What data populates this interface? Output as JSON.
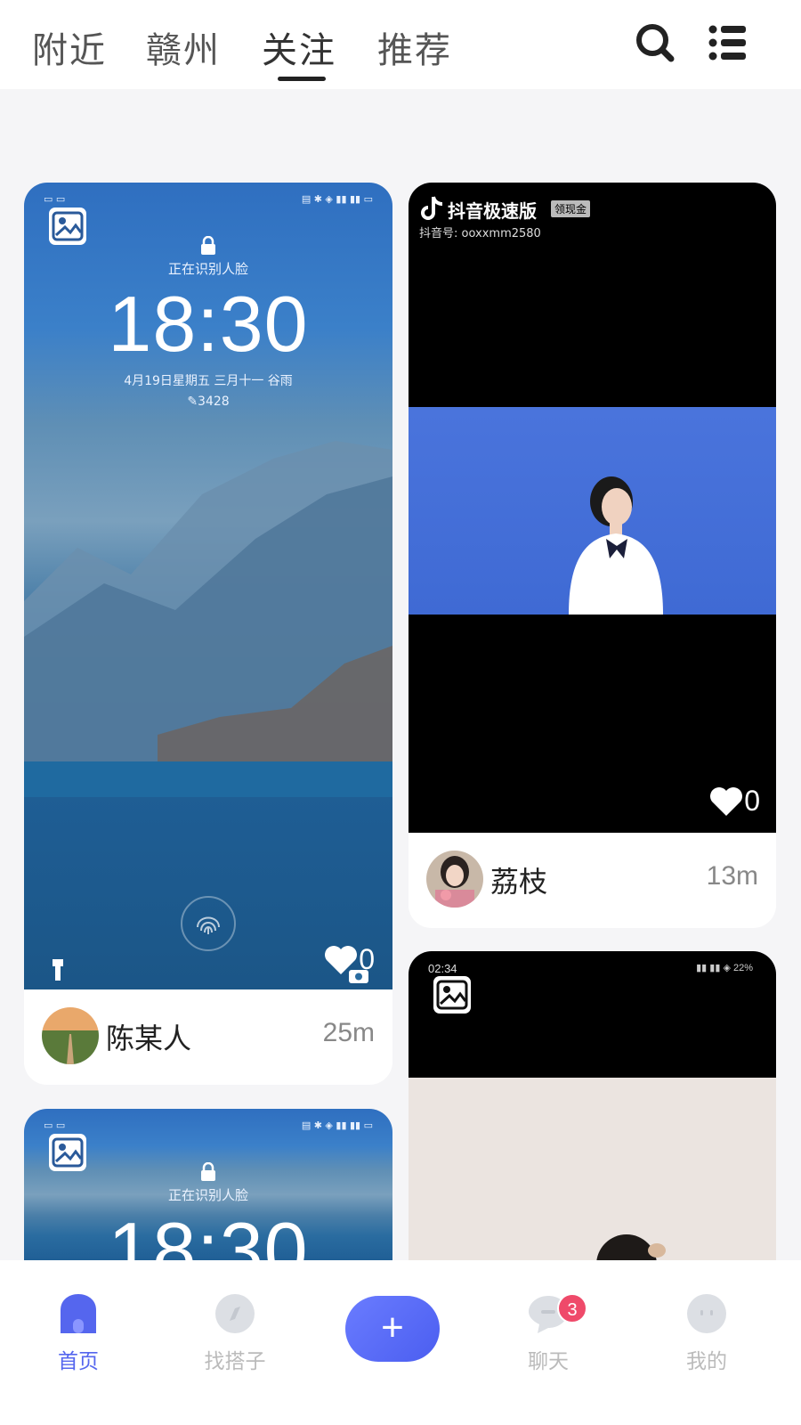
{
  "header": {
    "tabs": [
      {
        "label": "附近"
      },
      {
        "label": "赣州"
      },
      {
        "label": "关注"
      },
      {
        "label": "推荐"
      }
    ],
    "active_tab": "关注",
    "icons": [
      "search-icon",
      "menu-list-icon"
    ]
  },
  "feed": {
    "cards": [
      {
        "lock_status": "正在识别人脸",
        "lock_time": "18:30",
        "lock_date": "4月19日星期五 三月十一 谷雨",
        "lock_steps": "3428",
        "likes": "0",
        "user": "陈某人",
        "distance": "25m"
      },
      {
        "app_brand": "抖音极速版",
        "app_badge": "领现金",
        "douyin_id": "抖音号: ooxxmm2580",
        "likes": "0",
        "user": "荔枝",
        "distance": "13m"
      },
      {
        "status_time": "02:34",
        "battery": "22%"
      },
      {
        "lock_status": "正在识别人脸",
        "lock_time": "18:30"
      }
    ]
  },
  "bottom_nav": {
    "items": [
      {
        "label": "首页"
      },
      {
        "label": "找搭子"
      },
      {
        "label": "+"
      },
      {
        "label": "聊天"
      },
      {
        "label": "我的"
      }
    ],
    "active": "首页",
    "chat_badge": "3"
  },
  "colors": {
    "accent": "#5566ee",
    "badge": "#ef4a6a",
    "inactive": "#bbbbbb"
  }
}
